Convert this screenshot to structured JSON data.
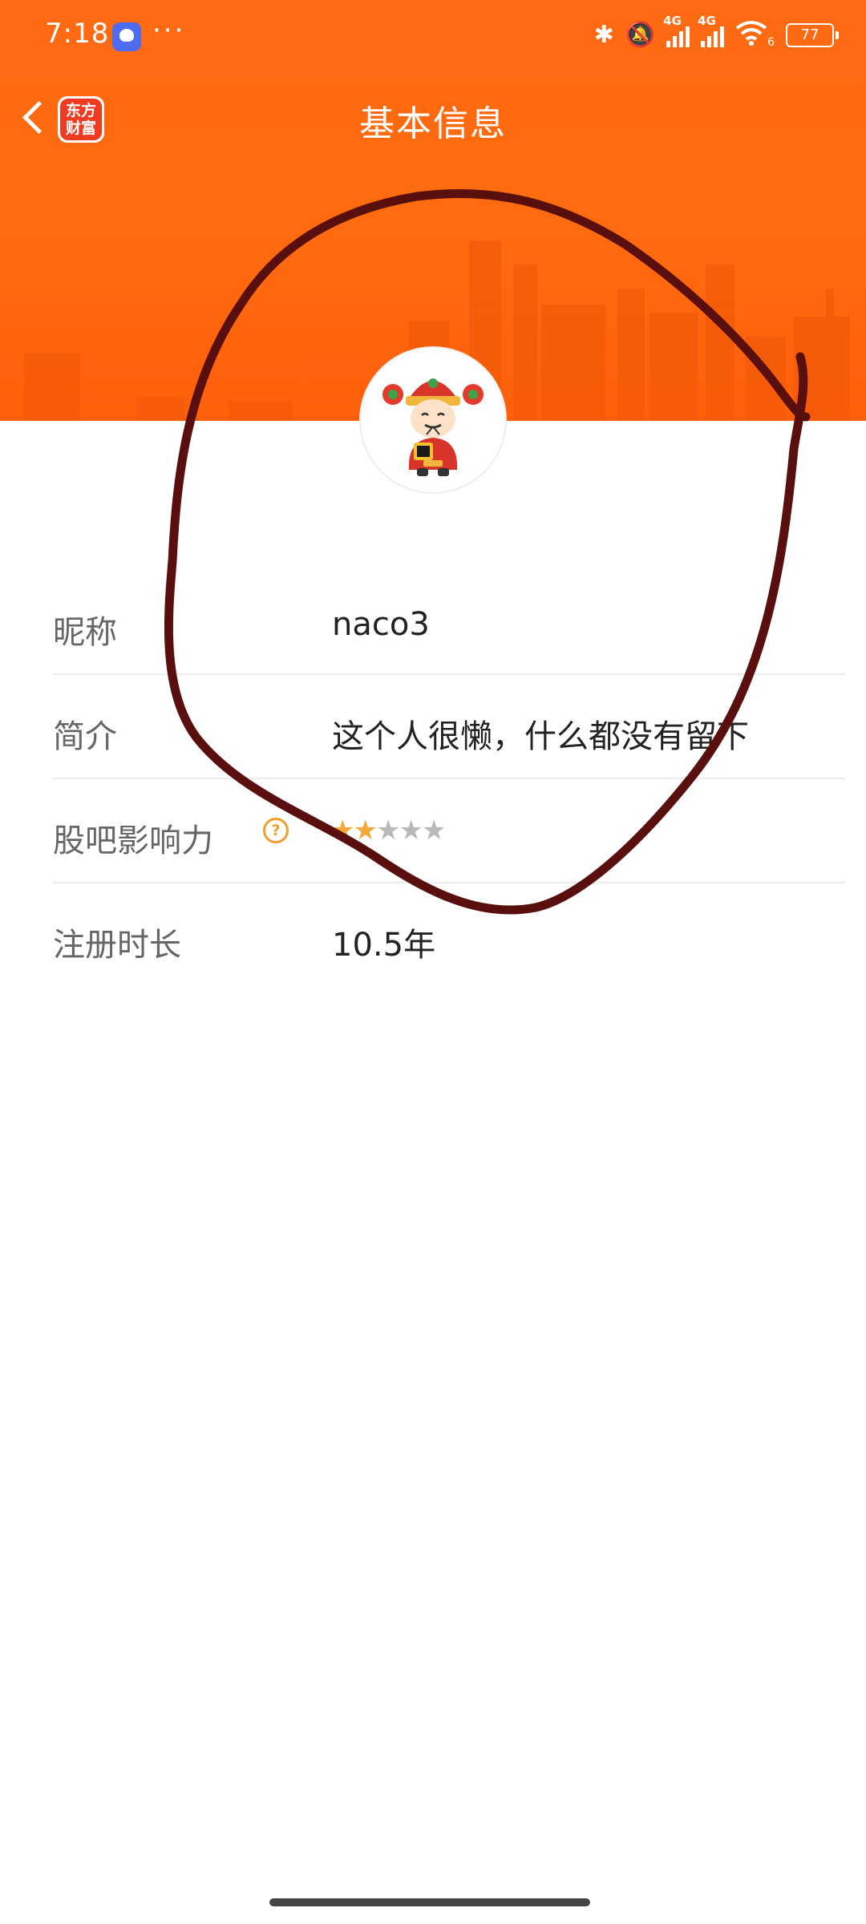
{
  "status_bar": {
    "time": "7:18",
    "more": "···",
    "network_1": "4G",
    "network_2": "4G",
    "wifi_suffix": "6",
    "battery": "77",
    "icons": [
      "app-notification-icon",
      "bluetooth-icon",
      "mute-icon",
      "signal-icon",
      "signal-icon",
      "wifi-icon",
      "battery-icon"
    ]
  },
  "header": {
    "title": "基本信息",
    "logo_line1": "东方",
    "logo_line2": "财富",
    "back_icon": "chevron-left-icon"
  },
  "colors": {
    "header_orange": "#ff6a12",
    "logo_red": "#ee3b22",
    "star_active": "#f4a93a",
    "star_inactive": "#b9b9b9",
    "help_icon": "#f0a02a",
    "annotation_ink": "#5a0f0f"
  },
  "profile": {
    "rows": [
      {
        "label": "昵称",
        "value": "naco3"
      },
      {
        "label": "简介",
        "value": "这个人很懒，什么都没有留下"
      },
      {
        "label": "股吧影响力",
        "rating": 2,
        "rating_max": 5,
        "help_icon": "question-circle-icon"
      },
      {
        "label": "注册时长",
        "value": "10.5年"
      }
    ]
  }
}
